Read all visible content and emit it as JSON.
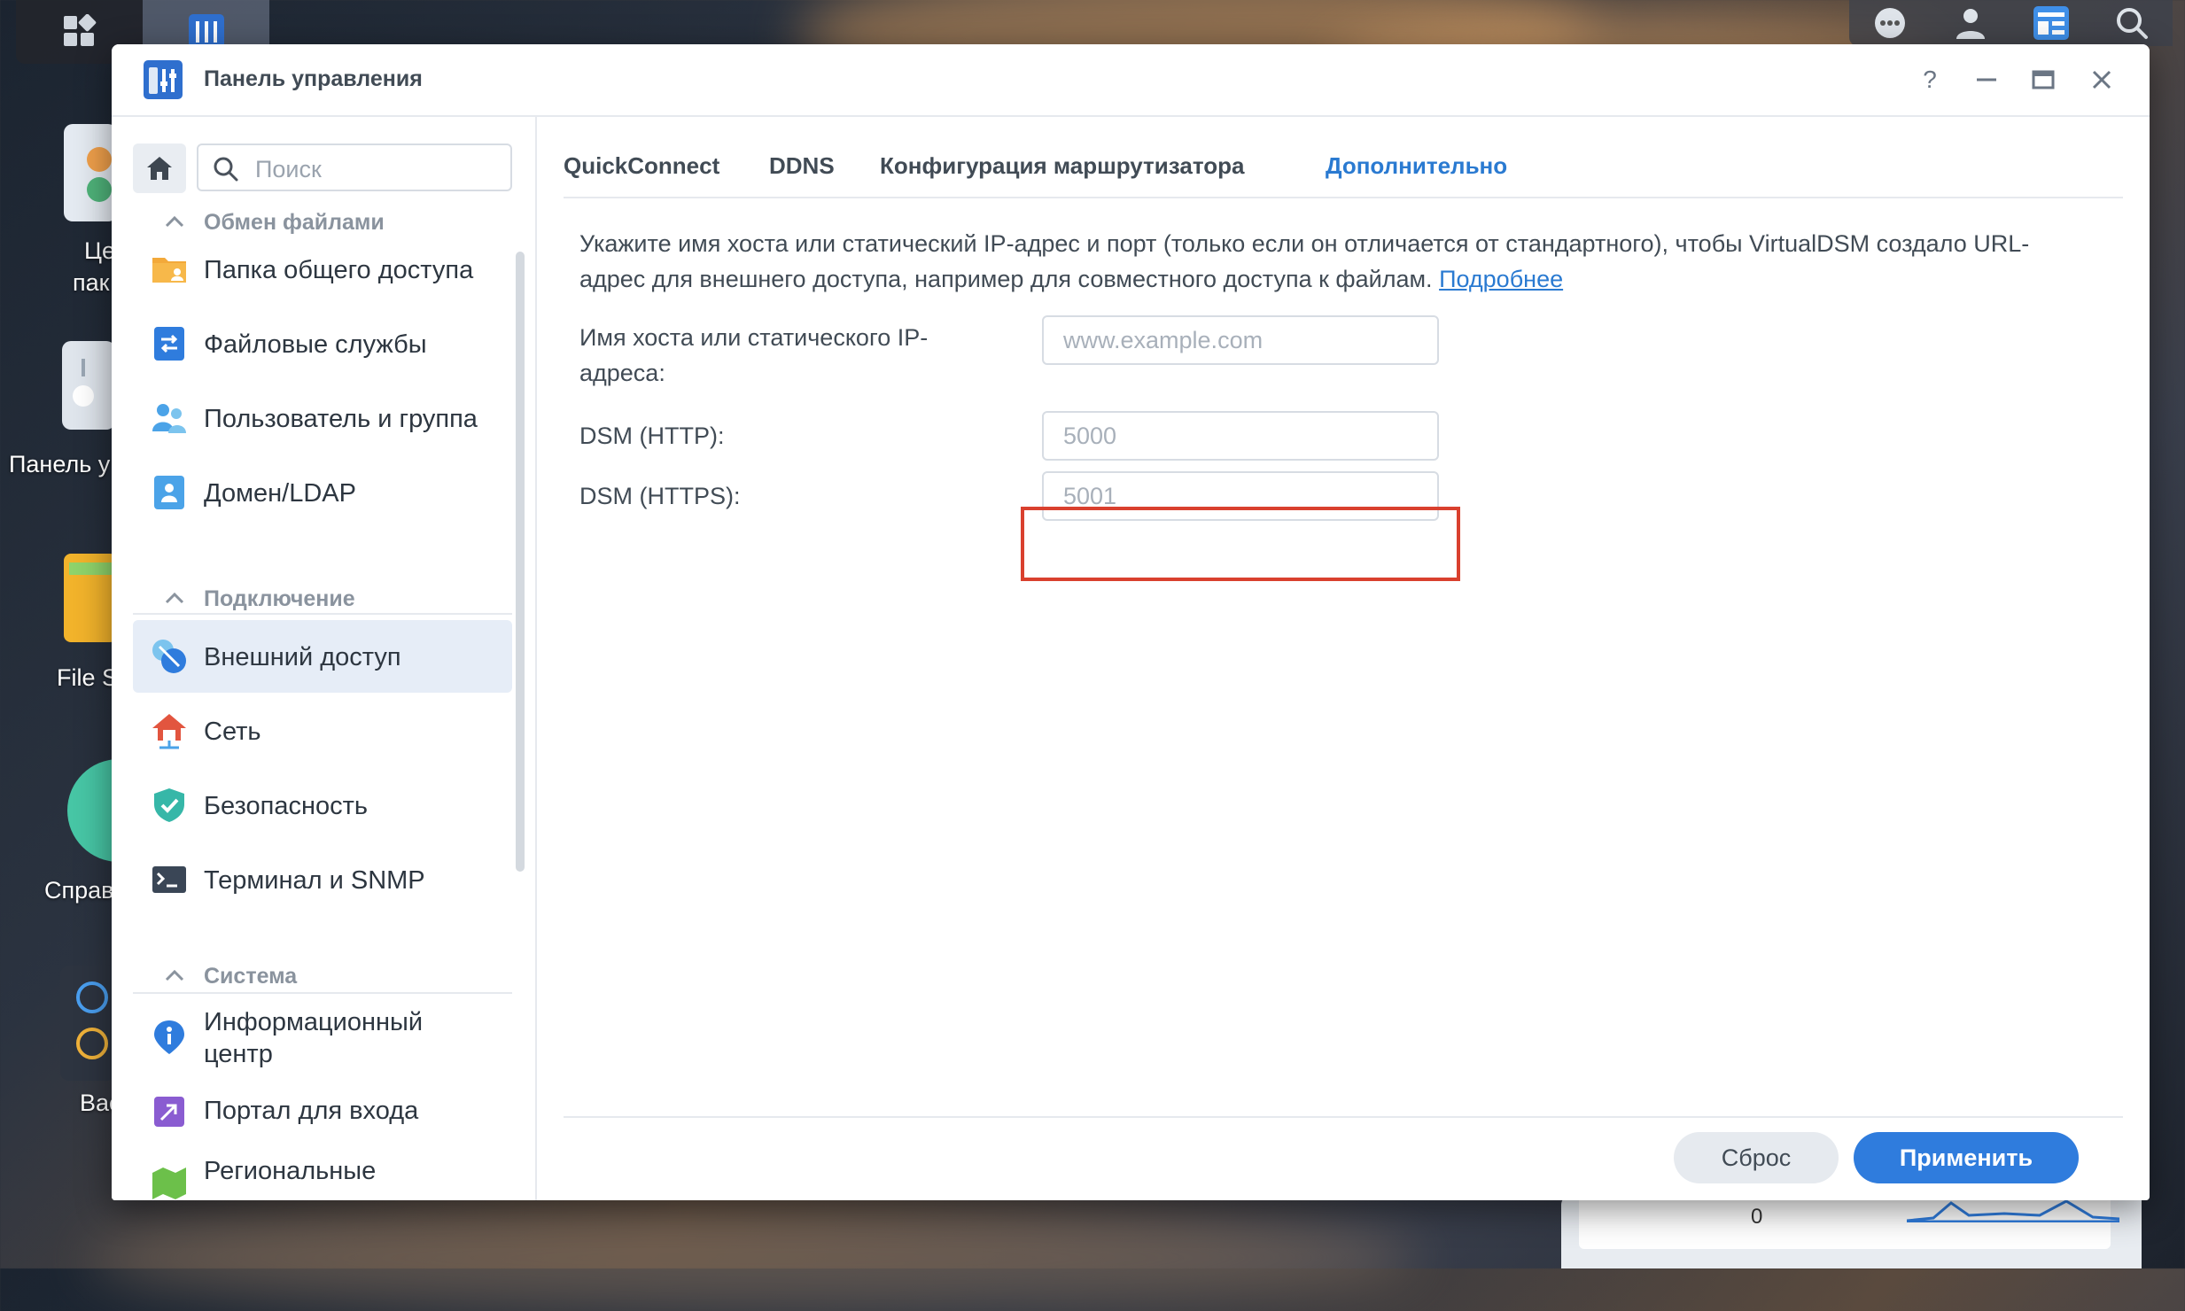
{
  "window": {
    "title": "Панель управления",
    "controls": {
      "help": "?"
    }
  },
  "desktop": {
    "icons": [
      {
        "label": "Це",
        "label2": "пак"
      },
      {
        "label": "Панель у"
      },
      {
        "label": "File S"
      },
      {
        "label": "Справ"
      },
      {
        "label": "Bac"
      }
    ],
    "widget_value": "0"
  },
  "sidebar": {
    "search_placeholder": "Поиск",
    "sections": [
      {
        "title": "Обмен файлами",
        "items": [
          {
            "label": "Папка общего доступа",
            "icon": "shared-folder-icon"
          },
          {
            "label": "Файловые службы",
            "icon": "file-services-icon"
          },
          {
            "label": "Пользователь и группа",
            "icon": "user-group-icon"
          },
          {
            "label": "Домен/LDAP",
            "icon": "domain-ldap-icon"
          }
        ]
      },
      {
        "title": "Подключение",
        "items": [
          {
            "label": "Внешний доступ",
            "icon": "external-access-icon",
            "active": true
          },
          {
            "label": "Сеть",
            "icon": "network-icon"
          },
          {
            "label": "Безопасность",
            "icon": "security-shield-icon"
          },
          {
            "label": "Терминал и SNMP",
            "icon": "terminal-icon"
          }
        ]
      },
      {
        "title": "Система",
        "items": [
          {
            "label": "Информационный центр",
            "icon": "info-center-icon"
          },
          {
            "label": "Портал для входа",
            "icon": "login-portal-icon"
          },
          {
            "label": "Региональные",
            "icon": "regional-options-icon"
          }
        ]
      }
    ]
  },
  "tabs": [
    {
      "label": "QuickConnect"
    },
    {
      "label": "DDNS"
    },
    {
      "label": "Конфигурация маршрутизатора"
    },
    {
      "label": "Дополнительно",
      "active": true
    }
  ],
  "content": {
    "description": "Укажите имя хоста или статический IP-адрес и порт (только если он отличается от стандартного), чтобы VirtualDSM создало URL-адрес для внешнего доступа, например для совместного доступа к файлам.",
    "more_link": "Подробнее",
    "fields": [
      {
        "label": "Имя хоста или статического IP-адреса:",
        "value": "",
        "placeholder": "www.example.com"
      },
      {
        "label": "DSM (HTTP):",
        "value": "",
        "placeholder": "5000"
      },
      {
        "label": "DSM (HTTPS):",
        "value": "",
        "placeholder": "5001"
      }
    ]
  },
  "footer": {
    "reset": "Сброс",
    "apply": "Применить"
  },
  "colors": {
    "accent": "#2f7cdd",
    "active_tab": "#2a7ad1",
    "highlight": "#d9402e"
  }
}
